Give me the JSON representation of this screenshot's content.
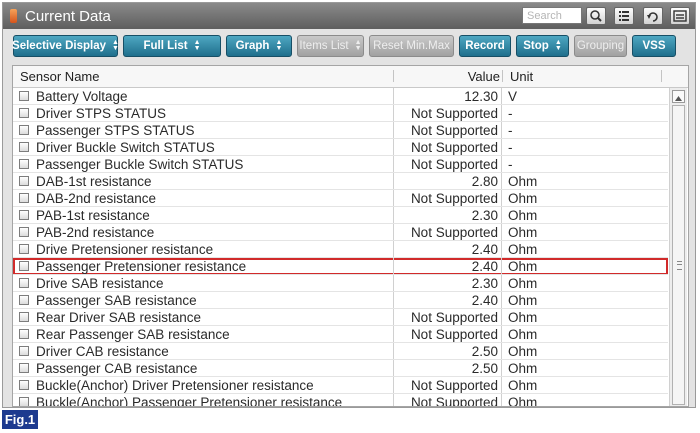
{
  "window": {
    "title": "Current Data",
    "search_placeholder": "Search",
    "icons": [
      "search-icon",
      "list-icon",
      "retry-icon",
      "menu-icon"
    ]
  },
  "toolbar": {
    "selective_display": "Selective Display",
    "full_list": "Full List",
    "graph": "Graph",
    "items_list": "Items List",
    "reset_minmax": "Reset Min.Max",
    "record": "Record",
    "stop": "Stop",
    "grouping": "Grouping",
    "vss": "VSS"
  },
  "table": {
    "columns": {
      "name": "Sensor Name",
      "value": "Value",
      "unit": "Unit"
    },
    "selected_row": 10,
    "rows": [
      {
        "name": "Battery Voltage",
        "value": "12.30",
        "unit": "V"
      },
      {
        "name": "Driver STPS STATUS",
        "value": "Not Supported",
        "unit": "-"
      },
      {
        "name": "Passenger STPS STATUS",
        "value": "Not Supported",
        "unit": "-"
      },
      {
        "name": "Driver Buckle Switch STATUS",
        "value": "Not Supported",
        "unit": "-"
      },
      {
        "name": "Passenger Buckle Switch STATUS",
        "value": "Not Supported",
        "unit": "-"
      },
      {
        "name": "DAB-1st resistance",
        "value": "2.80",
        "unit": "Ohm"
      },
      {
        "name": "DAB-2nd resistance",
        "value": "Not Supported",
        "unit": "Ohm"
      },
      {
        "name": "PAB-1st resistance",
        "value": "2.30",
        "unit": "Ohm"
      },
      {
        "name": "PAB-2nd resistance",
        "value": "Not Supported",
        "unit": "Ohm"
      },
      {
        "name": "Drive Pretensioner resistance",
        "value": "2.40",
        "unit": "Ohm"
      },
      {
        "name": "Passenger Pretensioner resistance",
        "value": "2.40",
        "unit": "Ohm"
      },
      {
        "name": "Drive SAB resistance",
        "value": "2.30",
        "unit": "Ohm"
      },
      {
        "name": "Passenger SAB resistance",
        "value": "2.40",
        "unit": "Ohm"
      },
      {
        "name": "Rear Driver SAB resistance",
        "value": "Not Supported",
        "unit": "Ohm"
      },
      {
        "name": "Rear Passenger SAB resistance",
        "value": "Not Supported",
        "unit": "Ohm"
      },
      {
        "name": "Driver CAB resistance",
        "value": "2.50",
        "unit": "Ohm"
      },
      {
        "name": "Passenger CAB resistance",
        "value": "2.50",
        "unit": "Ohm"
      },
      {
        "name": "Buckle(Anchor) Driver Pretensioner resistance",
        "value": "Not Supported",
        "unit": "Ohm"
      },
      {
        "name": "Buckle(Anchor) Passenger Pretensioner resistance",
        "value": "Not Supported",
        "unit": "Ohm"
      }
    ]
  },
  "figure_label": "Fig.1",
  "colors": {
    "titlebar": "#6e6e6e",
    "button": "#2e86a6",
    "button_disabled": "#b3b3b3",
    "selection_outline": "#d12a2a",
    "figure_label_bg": "#1d3a8f"
  }
}
